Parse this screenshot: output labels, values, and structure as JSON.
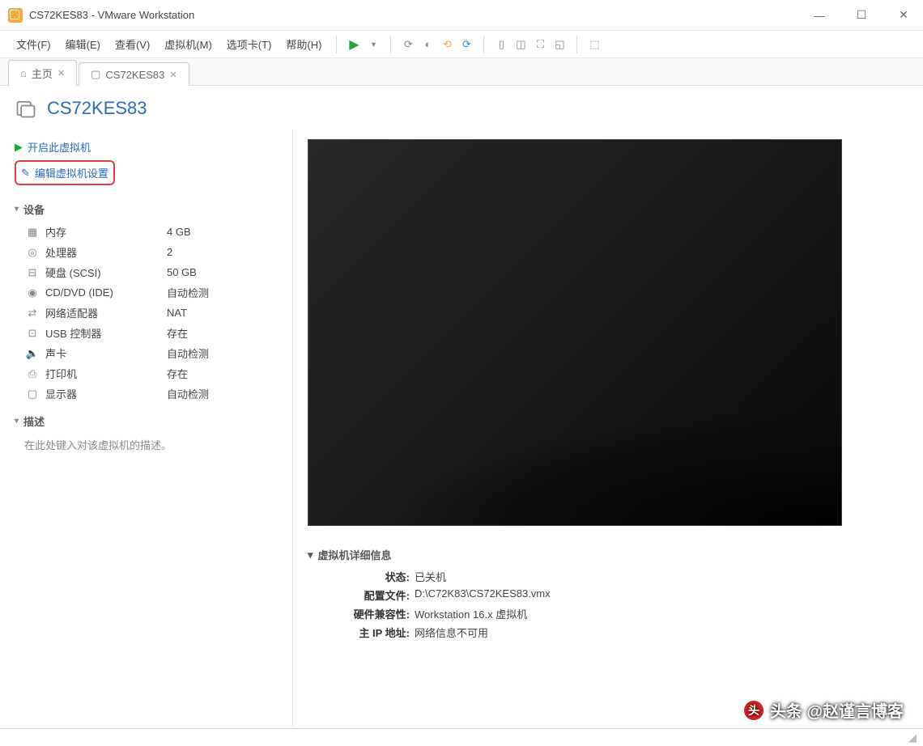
{
  "titlebar": {
    "title": "CS72KES83 - VMware Workstation"
  },
  "menubar": {
    "items": [
      "文件(F)",
      "编辑(E)",
      "查看(V)",
      "虚拟机(M)",
      "选项卡(T)",
      "帮助(H)"
    ]
  },
  "tabs": {
    "home": "主页",
    "vm": "CS72KES83"
  },
  "vm": {
    "title": "CS72KES83"
  },
  "actions": {
    "power_on": "开启此虚拟机",
    "edit_settings": "编辑虚拟机设置"
  },
  "sections": {
    "devices": "设备",
    "description": "描述",
    "details": "虚拟机详细信息"
  },
  "devices": [
    {
      "icon": "memory",
      "label": "内存",
      "value": "4 GB"
    },
    {
      "icon": "cpu",
      "label": "处理器",
      "value": "2"
    },
    {
      "icon": "disk",
      "label": "硬盘 (SCSI)",
      "value": "50 GB"
    },
    {
      "icon": "disc",
      "label": "CD/DVD (IDE)",
      "value": "自动检测"
    },
    {
      "icon": "network",
      "label": "网络适配器",
      "value": "NAT"
    },
    {
      "icon": "usb",
      "label": "USB 控制器",
      "value": "存在"
    },
    {
      "icon": "sound",
      "label": "声卡",
      "value": "自动检测"
    },
    {
      "icon": "printer",
      "label": "打印机",
      "value": "存在"
    },
    {
      "icon": "display",
      "label": "显示器",
      "value": "自动检测"
    }
  ],
  "description": {
    "placeholder": "在此处键入对该虚拟机的描述。"
  },
  "details": {
    "state_label": "状态:",
    "state_value": "已关机",
    "config_label": "配置文件:",
    "config_value": "D:\\C72K83\\CS72KES83.vmx",
    "hw_label": "硬件兼容性:",
    "hw_value": "Workstation 16.x 虚拟机",
    "ip_label": "主 IP 地址:",
    "ip_value": "网络信息不可用"
  },
  "watermark": {
    "text": "头条 @赵谨言博客"
  }
}
